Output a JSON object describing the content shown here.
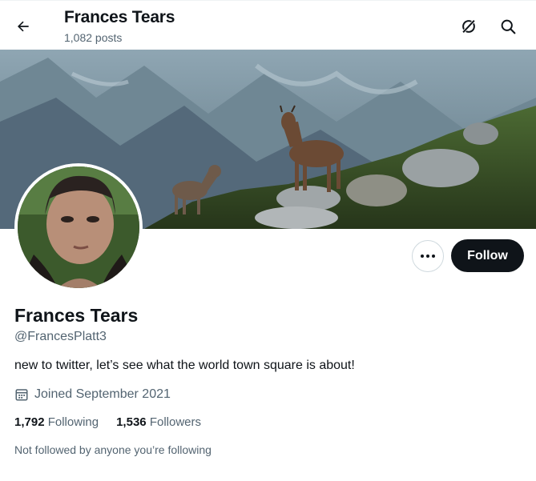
{
  "header": {
    "name": "Frances Tears",
    "posts": "1,082 posts"
  },
  "profile": {
    "display_name": "Frances Tears",
    "handle": "@FrancesPlatt3",
    "bio": "new to twitter, let’s see what the world town square is about!",
    "joined": "Joined September 2021",
    "following_count": "1,792",
    "following_label": "Following",
    "followers_count": "1,536",
    "followers_label": "Followers",
    "not_followed": "Not followed by anyone you’re following"
  },
  "actions": {
    "follow_label": "Follow"
  },
  "icons": {
    "back": "back-arrow-icon",
    "grok": "grok-icon",
    "search": "search-icon",
    "more": "more-dots-icon",
    "calendar": "calendar-icon"
  },
  "colors": {
    "text_primary": "#0f1419",
    "text_secondary": "#536471",
    "follow_bg": "#0f1419",
    "border": "#cfd9de"
  }
}
